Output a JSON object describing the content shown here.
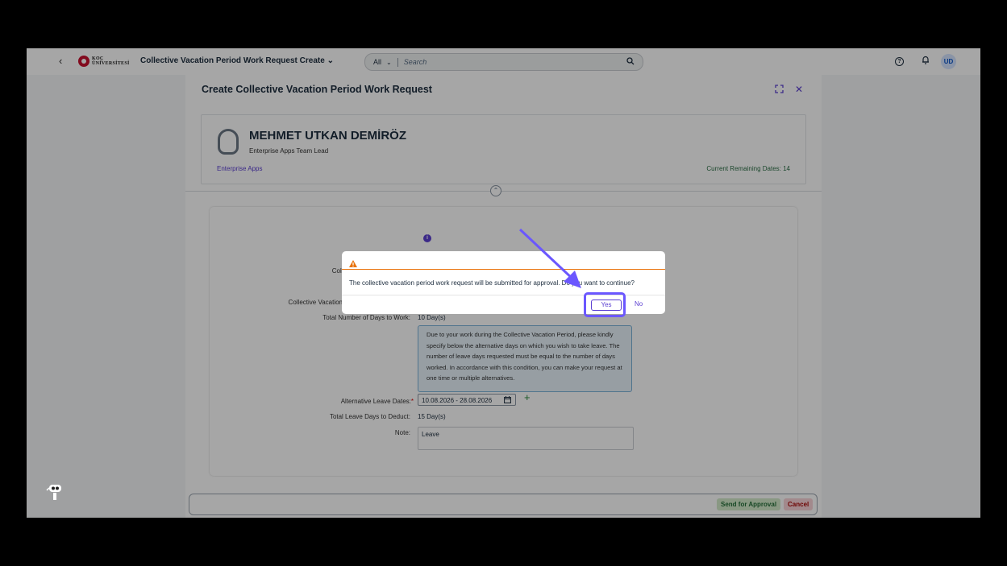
{
  "shell": {
    "logo_line1": "KOÇ",
    "logo_line2": "ÜNİVERSİTESİ",
    "app_title": "Collective Vacation Period Work Request Create",
    "search_scope": "All",
    "search_placeholder": "Search",
    "avatar_initials": "UD"
  },
  "dialog": {
    "title": "Create Collective Vacation Period Work Request",
    "employee": {
      "name": "MEHMET UTKAN DEMİRÖZ",
      "role": "Enterprise Apps Team Lead",
      "department": "Enterprise Apps",
      "remaining": "Current Remaining Dates: 14"
    },
    "form": {
      "label_partial_1": "Colle",
      "label_partial_2": "Collective Vacation",
      "total_work_label": "Total Number of Days to Work:",
      "total_work_value": "10 Day(s)",
      "info_text": "Due to your work during the Collective Vacation Period, please kindly specify below the alternative days on which you wish to take leave. The number of leave days requested must be equal to the number of days worked. In accordance with this condition, you can make your request at one time or multiple alternatives.",
      "alt_dates_label": "Alternative Leave Dates:",
      "required_mark": "*",
      "alt_dates_value": "10.08.2026 - 28.08.2026",
      "deduct_label": "Total Leave Days to Deduct:",
      "deduct_value": "15 Day(s)",
      "note_label": "Note:",
      "note_value": "Leave"
    },
    "footer": {
      "send_label": "Send for Approval",
      "cancel_label": "Cancel"
    }
  },
  "confirm": {
    "message": "The collective vacation period work request will be submitted for approval. Do you want to continue?",
    "yes_label": "Yes",
    "no_label": "No"
  },
  "colors": {
    "accent": "#5b3fd1",
    "warning": "#e9730c",
    "highlight": "#6b57ff"
  }
}
